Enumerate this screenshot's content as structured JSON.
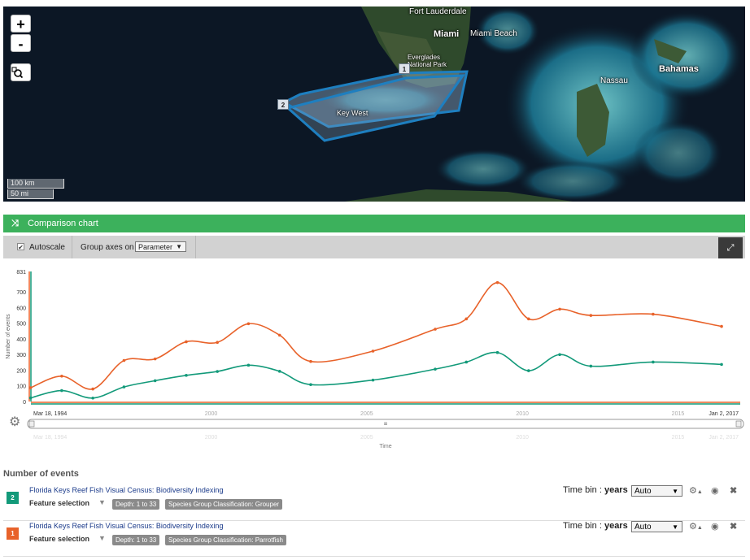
{
  "map": {
    "zoom_in": "+",
    "zoom_out": "-",
    "labels": {
      "fort_lauderdale": "Fort Lauderdale",
      "miami": "Miami",
      "miami_beach": "Miami Beach",
      "everglades": "Everglades\nNational Park",
      "key_west": "Key West",
      "nassau": "Nassau",
      "bahamas": "Bahamas"
    },
    "scale_km": "100 km",
    "scale_mi": "50 mi",
    "markers": [
      "1",
      "2"
    ]
  },
  "panel": {
    "title": "Comparison chart",
    "autoscale_label": "Autoscale",
    "group_axes_label": "Group axes on",
    "group_axes_value": "Parameter"
  },
  "colors": {
    "orange": "#e8622a",
    "teal": "#139a7a",
    "header_green": "#3cb15c"
  },
  "chart_data": {
    "type": "line",
    "ylabel": "Number of events",
    "xlabel": "Time",
    "ylim": [
      0,
      831
    ],
    "y_ticks": [
      "0",
      "100",
      "200",
      "300",
      "400",
      "500",
      "600",
      "700",
      "831"
    ],
    "x_ticks": [
      "2000",
      "2005",
      "2010",
      "2015"
    ],
    "x_start_label": "Mar 18, 1994",
    "x_end_label": "Jan 2, 2017",
    "x_range": [
      1994.21,
      2017.0
    ],
    "series": [
      {
        "color": "#e8622a",
        "points": [
          [
            1994.2,
            88
          ],
          [
            1995.2,
            162
          ],
          [
            1996.2,
            80
          ],
          [
            1997.2,
            262
          ],
          [
            1998.2,
            272
          ],
          [
            1999.2,
            382
          ],
          [
            2000.2,
            378
          ],
          [
            2001.2,
            497
          ],
          [
            2002.2,
            424
          ],
          [
            2003.2,
            256
          ],
          [
            2005.2,
            322
          ],
          [
            2007.2,
            462
          ],
          [
            2008.2,
            528
          ],
          [
            2009.2,
            760
          ],
          [
            2010.2,
            528
          ],
          [
            2011.2,
            590
          ],
          [
            2012.2,
            550
          ],
          [
            2014.2,
            558
          ],
          [
            2016.4,
            480
          ]
        ]
      },
      {
        "color": "#139a7a",
        "points": [
          [
            1994.2,
            23
          ],
          [
            1995.2,
            70
          ],
          [
            1996.2,
            22
          ],
          [
            1997.2,
            93
          ],
          [
            1998.2,
            133
          ],
          [
            1999.2,
            167
          ],
          [
            2000.2,
            192
          ],
          [
            2001.2,
            232
          ],
          [
            2002.2,
            193
          ],
          [
            2003.2,
            108
          ],
          [
            2005.2,
            137
          ],
          [
            2007.2,
            207
          ],
          [
            2008.2,
            252
          ],
          [
            2009.2,
            313
          ],
          [
            2010.2,
            197
          ],
          [
            2011.2,
            300
          ],
          [
            2012.2,
            226
          ],
          [
            2014.2,
            252
          ],
          [
            2016.4,
            237
          ]
        ]
      }
    ],
    "navigator_ticks": [
      "Mar 18, 1994",
      "2000",
      "2005",
      "2010",
      "2015",
      "Jan 2, 2017"
    ],
    "navigator_handle": "≡"
  },
  "layers": {
    "title": "Number of events",
    "rows": [
      {
        "badge": "2",
        "badge_color": "#139a7a",
        "name": "Florida Keys Reef Fish Visual Census: Biodiversity Indexing",
        "feature_label": "Feature selection",
        "tags": [
          "Depth: 1 to 33",
          "Species Group Classification: Grouper"
        ],
        "timebin_label": "Time bin :",
        "timebin_unit": "years",
        "timebin_value": "Auto"
      },
      {
        "badge": "1",
        "badge_color": "#e8622a",
        "name": "Florida Keys Reef Fish Visual Census: Biodiversity Indexing",
        "feature_label": "Feature selection",
        "tags": [
          "Depth: 1 to 33",
          "Species Group Classification: Parrotfish"
        ],
        "timebin_label": "Time bin :",
        "timebin_unit": "years",
        "timebin_value": "Auto"
      }
    ]
  }
}
